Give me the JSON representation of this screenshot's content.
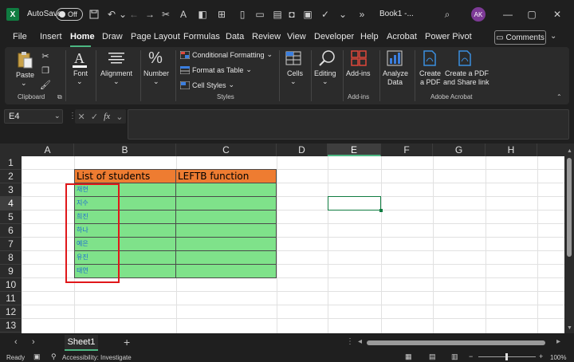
{
  "titlebar": {
    "autosave_label": "AutoSave",
    "autosave_state": "Off",
    "doc_title": "Book1 -...",
    "user_initials": "AK",
    "more_label": "»"
  },
  "menu": {
    "tabs": [
      "File",
      "Insert",
      "Home",
      "Draw",
      "Page Layout",
      "Formulas",
      "Data",
      "Review",
      "View",
      "Developer",
      "Help",
      "Acrobat",
      "Power Pivot"
    ],
    "active_tab": "Home",
    "comments_label": "Comments"
  },
  "ribbon": {
    "clipboard": {
      "paste_label": "Paste",
      "group_label": "Clipboard"
    },
    "font": {
      "label": "Font"
    },
    "alignment": {
      "label": "Alignment"
    },
    "number": {
      "label": "Number"
    },
    "styles": {
      "conditional_formatting": "Conditional Formatting",
      "format_as_table": "Format as Table",
      "cell_styles": "Cell Styles",
      "group_label": "Styles"
    },
    "cells": {
      "label": "Cells"
    },
    "editing": {
      "label": "Editing"
    },
    "addins": {
      "label": "Add-ins",
      "group_label": "Add-ins"
    },
    "analyze": {
      "label_line1": "Analyze",
      "label_line2": "Data"
    },
    "acrobat": {
      "create_pdf_line1": "Create",
      "create_pdf_line2": "a PDF",
      "create_share_line1": "Create a PDF",
      "create_share_line2": "and Share link",
      "group_label": "Adobe Acrobat"
    }
  },
  "formula_bar": {
    "name_box": "E4",
    "fx_label": "fx",
    "value": ""
  },
  "grid": {
    "columns": [
      "A",
      "B",
      "C",
      "D",
      "E",
      "F",
      "G",
      "H"
    ],
    "rows": [
      "1",
      "2",
      "3",
      "4",
      "5",
      "6",
      "7",
      "8",
      "9",
      "10",
      "11",
      "12",
      "13"
    ],
    "selected_column": "E",
    "selected_row": "4",
    "header_b2": "List of students",
    "header_c2": "LEFTB function",
    "students": [
      "재현",
      "지수",
      "희진",
      "하나",
      "예은",
      "유진",
      "태연"
    ],
    "fill_colors": {
      "header": "#ee7c31",
      "data": "#7fe28a",
      "highlight_box": "#e0171a"
    }
  },
  "sheets": {
    "tabs": [
      "Sheet1"
    ],
    "active": "Sheet1"
  },
  "status": {
    "ready": "Ready",
    "accessibility": "Accessibility: Investigate",
    "zoom": "100%"
  }
}
